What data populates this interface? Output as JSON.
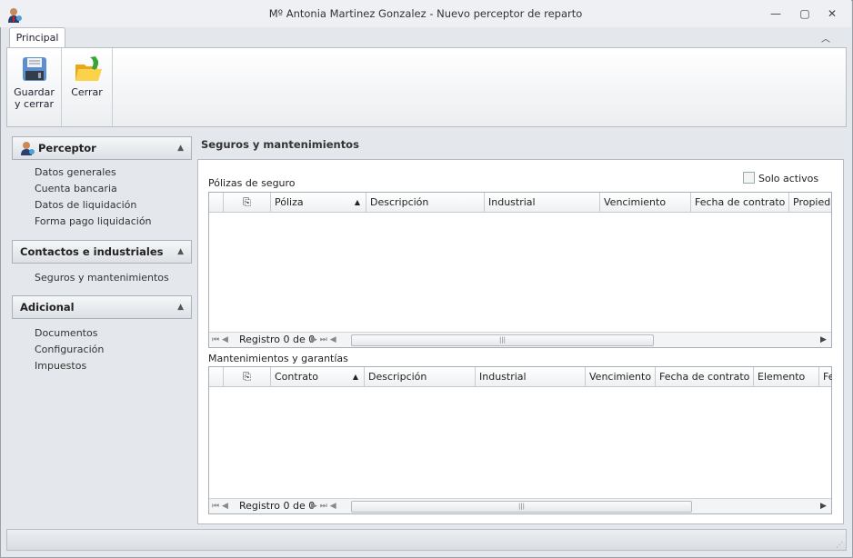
{
  "window": {
    "title": "Mº Antonia Martinez Gonzalez - Nuevo perceptor de reparto",
    "minimize": "—",
    "maximize": "▢",
    "close": "✕"
  },
  "ribbon": {
    "tab": "Principal",
    "collapse": "︿",
    "save_line1": "Guardar",
    "save_line2": "y cerrar",
    "close": "Cerrar"
  },
  "sidebar": {
    "groups": [
      {
        "title": "Perceptor",
        "items": [
          "Datos generales",
          "Cuenta bancaria",
          "Datos de liquidación",
          "Forma pago liquidación"
        ]
      },
      {
        "title": "Contactos e industriales",
        "items": [
          "Seguros y mantenimientos"
        ]
      },
      {
        "title": "Adicional",
        "items": [
          "Documentos",
          "Configuración",
          "Impuestos"
        ]
      }
    ]
  },
  "content": {
    "title": "Seguros y mantenimientos",
    "solo_activos": "Solo activos",
    "grid1": {
      "label": "Pólizas de seguro",
      "columns": [
        "Póliza",
        "Descripción",
        "Industrial",
        "Vencimiento",
        "Fecha de contrato",
        "Propieda"
      ],
      "record": "Registro 0 de 0"
    },
    "grid2": {
      "label": "Mantenimientos y garantías",
      "columns": [
        "Contrato",
        "Descripción",
        "Industrial",
        "Vencimiento",
        "Fecha de contrato",
        "Elemento",
        "Fe"
      ],
      "record": "Registro 0 de 0"
    }
  }
}
